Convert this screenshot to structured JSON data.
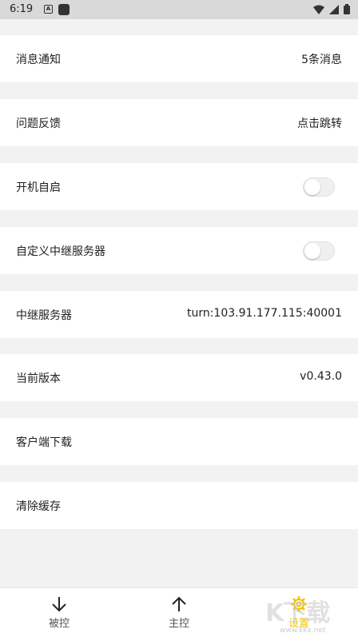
{
  "status_bar": {
    "time": "6:19",
    "notif_badge": "A"
  },
  "settings": [
    {
      "label": "消息通知",
      "value": "5条消息"
    },
    {
      "label": "问题反馈",
      "value": "点击跳转"
    },
    {
      "label": "开机自启",
      "toggle": false
    },
    {
      "label": "自定义中继服务器",
      "toggle": false
    },
    {
      "label": "中继服务器",
      "value": "turn:103.91.177.115:40001"
    },
    {
      "label": "当前版本",
      "value": "v0.43.0"
    },
    {
      "label": "客户端下载"
    },
    {
      "label": "清除缓存"
    }
  ],
  "bottom_nav": [
    {
      "label": "被控",
      "icon": "arrow-down-icon",
      "active": false
    },
    {
      "label": "主控",
      "icon": "arrow-up-icon",
      "active": false
    },
    {
      "label": "设置",
      "icon": "gear-icon",
      "active": true
    }
  ],
  "watermark": {
    "text": "K下载",
    "sub": "www.kkx.net"
  },
  "colors": {
    "active": "#f2c200",
    "background": "#f2f2f2",
    "row": "#ffffff"
  }
}
